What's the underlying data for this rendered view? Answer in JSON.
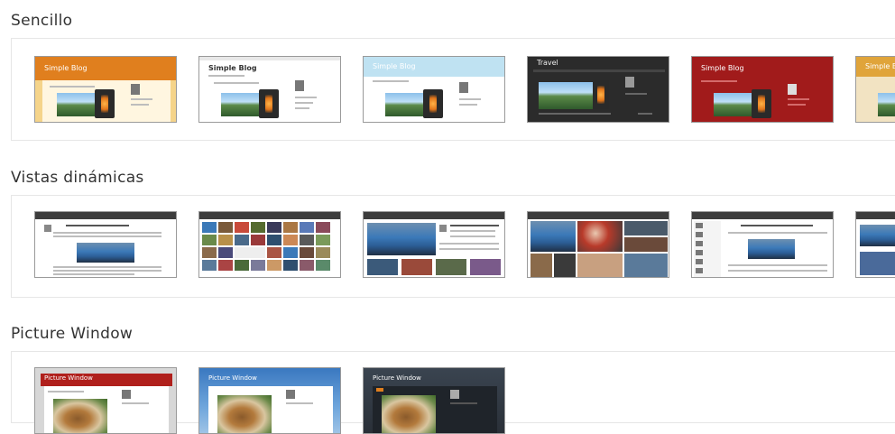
{
  "sections": [
    {
      "title": "Sencillo",
      "templates": [
        {
          "variant": "orange",
          "blog_title": "Simple Blog"
        },
        {
          "variant": "white",
          "blog_title": "Simple Blog"
        },
        {
          "variant": "lightblue",
          "blog_title": "Simple Blog"
        },
        {
          "variant": "dark",
          "blog_title": "Travel"
        },
        {
          "variant": "red",
          "blog_title": "Simple Blog"
        },
        {
          "variant": "gold",
          "blog_title": "Simple Blog"
        }
      ]
    },
    {
      "title": "Vistas dinámicas",
      "templates": [
        {
          "variant": "classic"
        },
        {
          "variant": "flipcard"
        },
        {
          "variant": "magazine"
        },
        {
          "variant": "mosaic"
        },
        {
          "variant": "sidebar"
        },
        {
          "variant": "snapshot"
        }
      ]
    },
    {
      "title": "Picture Window",
      "templates": [
        {
          "variant": "red",
          "blog_title": "Picture Window"
        },
        {
          "variant": "blue",
          "blog_title": "Picture Window"
        },
        {
          "variant": "dark",
          "blog_title": "Picture Window"
        }
      ]
    }
  ],
  "colors": {
    "orange": "#e07f1e",
    "lightblue": "#6fb6dd",
    "dark": "#2b2b2b",
    "red": "#a11b1b",
    "gold": "#e0a43a"
  }
}
